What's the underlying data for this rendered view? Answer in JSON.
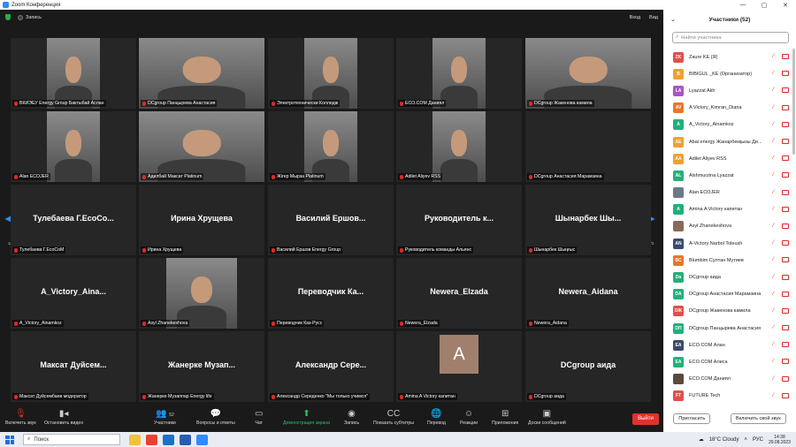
{
  "window": {
    "title": "Zoom Конференция",
    "controls": [
      "—",
      "▢",
      "✕"
    ]
  },
  "meeting": {
    "record_label": "Запись",
    "view_label": "Вход",
    "view2_label": "Вид"
  },
  "pagination": {
    "left": "3/3",
    "right": "3/3"
  },
  "tiles": [
    {
      "caption": "ВКИЭЕУ Energy Group Бактыбай Аслан",
      "video": true,
      "vidw": 60
    },
    {
      "caption": "DCgroup Панцырева Анастасия",
      "video": true,
      "vidw": 142
    },
    {
      "caption": "Электротехнически Колледж",
      "video": true,
      "vidw": 60
    },
    {
      "caption": "ECO.COM Даниял",
      "video": true,
      "vidw": 60
    },
    {
      "caption": "DCgroup Жакенова камила",
      "video": true,
      "vidw": 142
    },
    {
      "caption": "Alan ECOJER",
      "video": true,
      "vidw": 60
    },
    {
      "caption": "Адилбай Максат Platinum",
      "video": true,
      "vidw": 142
    },
    {
      "caption": "Жігер Мырза Platinum",
      "video": true,
      "vidw": 60
    },
    {
      "caption": "Adilet Aliyev RSS",
      "video": true,
      "vidw": 60
    },
    {
      "caption": "DCgroup Анастасия Марамзина",
      "video": false,
      "big": ""
    },
    {
      "caption": "Тулебаева Г.EcoCoM",
      "video": false,
      "big": "Тулебаева  Г.EcoCo..."
    },
    {
      "caption": "Ирина Хрущева",
      "video": false,
      "big": "Ирина Хрущева"
    },
    {
      "caption": "Василий Ершов Energy Group",
      "video": false,
      "big": "Василий  Ершов..."
    },
    {
      "caption": "Руководитель команды Альянс",
      "video": false,
      "big": "Руководитель  к..."
    },
    {
      "caption": "Шынарбек Шыңғыс",
      "video": false,
      "big": "Шынарбек  Шы..."
    },
    {
      "caption": "A_Victory_Ainamkoz",
      "video": false,
      "big": "A_Victory_Aina..."
    },
    {
      "caption": "Asyl Zhanekeshova",
      "video": true,
      "vidw": 80
    },
    {
      "caption": "Переводчик Каз-Русс",
      "video": false,
      "big": "Переводчик  Ка..."
    },
    {
      "caption": "Newera_Elzada",
      "video": false,
      "big": "Newera_Elzada"
    },
    {
      "caption": "Newera_Aidana",
      "video": false,
      "big": "Newera_Aidana"
    },
    {
      "caption": "Максат Дуйсембаев модератор",
      "video": false,
      "big": "Максат  Дуйсем..."
    },
    {
      "caption": "Жанерке Музаппар Energy life",
      "video": false,
      "big": "Жанерке  Музап..."
    },
    {
      "caption": "Александр Середенко \"Мы только учимся\"",
      "video": false,
      "big": "Александр  Сере..."
    },
    {
      "caption": "Amina A Victory капитан",
      "video": false,
      "avatar": "A"
    },
    {
      "caption": "DCgroup аида",
      "video": false,
      "big": "DCgroup аида"
    }
  ],
  "toolbar": {
    "mute": "Включить звук",
    "video": "Остановить видео",
    "participants": "Участники",
    "participants_count": "52",
    "qa": "Вопросы и ответы",
    "chat": "Чат",
    "share": "Демонстрация экрана",
    "record": "Запись",
    "captions": "Показать субтитры",
    "translate": "Перевод",
    "reactions": "Реакции",
    "apps": "Приложения",
    "whiteboard": "Доски сообщений",
    "leave": "Выйти"
  },
  "panel": {
    "title": "Участники (52)",
    "search_placeholder": "Найти участника",
    "invite": "Пригласить",
    "unmute_self": "Включить свой звук",
    "participants": [
      {
        "initials": "ZK",
        "color": "#e0504a",
        "name": "Zaure KE (Я)"
      },
      {
        "initials": "B",
        "color": "#f0a030",
        "name": "BIBIGUL _KE (Организатор)"
      },
      {
        "initials": "LA",
        "color": "#a855c8",
        "name": "Lyazzat Akh"
      },
      {
        "initials": "AV",
        "color": "#e8762a",
        "name": "A Victory_Kimran_Diana"
      },
      {
        "initials": "A",
        "color": "#22b07a",
        "name": "A_Victory_Ainamkoz"
      },
      {
        "initials": "AE",
        "color": "#f0a030",
        "name": "Abai energy Жанарбекқызы Ди..."
      },
      {
        "initials": "AA",
        "color": "#f0a030",
        "name": "Adilet Aliyev RSS"
      },
      {
        "initials": "AL",
        "color": "#22b07a",
        "name": "Alshmurzina Lyazzat"
      },
      {
        "initials": "",
        "color": "#6a7a8a",
        "name": "Alan ECOJER"
      },
      {
        "initials": "A",
        "color": "#22b07a",
        "name": "Amina A Victory капитан"
      },
      {
        "initials": "",
        "color": "#8a6a5a",
        "name": "Asyl Zhanekeshova"
      },
      {
        "initials": "AN",
        "color": "#3a4a6a",
        "name": "A-Victory  Narbol Toleush"
      },
      {
        "initials": "BC",
        "color": "#e8762a",
        "name": "Blumbim Султан Мутиев"
      },
      {
        "initials": "Da",
        "color": "#22b07a",
        "name": "DCgroup аида"
      },
      {
        "initials": "DA",
        "color": "#22b07a",
        "name": "DCgroup Анастасия Марамзина"
      },
      {
        "initials": "DЖ",
        "color": "#e0504a",
        "name": "DCgroup Жакенова камила"
      },
      {
        "initials": "DП",
        "color": "#22b07a",
        "name": "DCgroup Панцырева Анастасия"
      },
      {
        "initials": "EA",
        "color": "#3a4a6a",
        "name": "ECO.COM Алан"
      },
      {
        "initials": "EA",
        "color": "#22b07a",
        "name": "ECO.COM Алиса"
      },
      {
        "initials": "",
        "color": "#5a4a3a",
        "name": "ECO.COM Даниял"
      },
      {
        "initials": "FT",
        "color": "#e0504a",
        "name": "FUTURE Tech"
      }
    ]
  },
  "taskbar": {
    "search": "Поиск",
    "weather": "18°C  Cloudy",
    "lang": "РУС",
    "time": "14:38",
    "date": "29.08.2023"
  }
}
